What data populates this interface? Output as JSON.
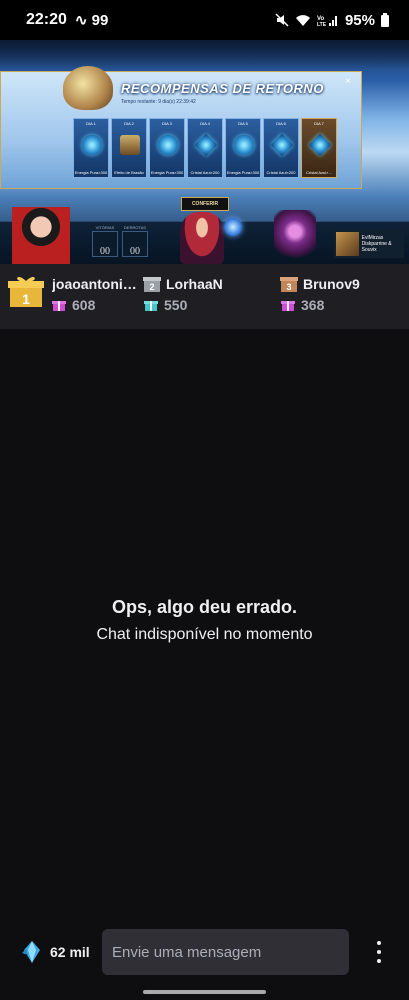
{
  "status_bar": {
    "time": "22:20",
    "extra": "99",
    "battery": "95%"
  },
  "stream": {
    "popup_title": "RECOMPENSAS DE RETORNO",
    "popup_subtitle": "Tempo restante: 9 dia(s) 22:39:42",
    "close": "×",
    "days": [
      {
        "label": "DIA 1",
        "reward": "Energia Pura×300",
        "kind": "orb"
      },
      {
        "label": "DIA 2",
        "reward": "Efeito de Brasão",
        "kind": "badge"
      },
      {
        "label": "DIA 3",
        "reward": "Energia Pura×300",
        "kind": "orb"
      },
      {
        "label": "DIA 4",
        "reward": "Cristal Azul×200",
        "kind": "crystal"
      },
      {
        "label": "DIA 5",
        "reward": "Energia Pura×300",
        "kind": "orb"
      },
      {
        "label": "DIA 6",
        "reward": "Cristal Azul×200",
        "kind": "crystal"
      },
      {
        "label": "DIA 7",
        "reward": "Cristal Azul×...",
        "kind": "crystal"
      }
    ],
    "check_button": "CONFERIR",
    "stat_left_label": "VITÓRIAS",
    "stat_left_value": "00",
    "stat_right_label": "DERROTAS",
    "stat_right_value": "00",
    "promo_title": "EvlMirzas",
    "promo_sub": "Diskparrine & Souvix"
  },
  "leaderboard": [
    {
      "rank": "1",
      "name": "joaoantoniol...",
      "count": "608"
    },
    {
      "rank": "2",
      "name": "LorhaaN",
      "count": "550"
    },
    {
      "rank": "3",
      "name": "Brunov9",
      "count": "368"
    }
  ],
  "chat": {
    "error_title": "Ops, algo deu errado.",
    "error_subtitle": "Chat indisponível no momento",
    "points": "62 mil",
    "input_placeholder": "Envie uma mensagem"
  },
  "colors": {
    "background": "#0e0e10",
    "leaderboard_bg": "#1f1f23",
    "input_bg": "#2f2f35",
    "gold": "#e8b73a",
    "silver": "#9aa0a6",
    "bronze": "#c08659",
    "gift_pink": "#d14bd6",
    "gift_teal": "#41c7c7"
  }
}
